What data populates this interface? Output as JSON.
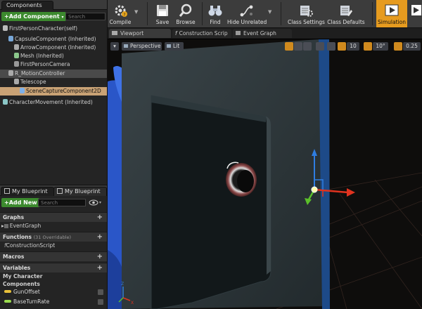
{
  "left": {
    "components_tab": "Components",
    "add_component": "+Add Component",
    "search_placeholder": "Search",
    "tree": [
      {
        "label": "FirstPersonCharacter(self)",
        "indent": 0
      },
      {
        "label": "CapsuleComponent (Inherited)",
        "indent": 1
      },
      {
        "label": "ArrowComponent (Inherited)",
        "indent": 2
      },
      {
        "label": "Mesh (Inherited)",
        "indent": 2
      },
      {
        "label": "FirstPersonCamera",
        "indent": 2
      },
      {
        "label": "R_MotionController",
        "indent": 1
      },
      {
        "label": "Telescope",
        "indent": 2
      },
      {
        "label": "SceneCaptureComponent2D",
        "indent": 3
      },
      {
        "label": "CharacterMovement (Inherited)",
        "indent": 0
      }
    ],
    "bp_tab1": "My Blueprint",
    "bp_tab2": "My Blueprint",
    "add_new": "+Add New",
    "bp_search_placeholder": "Search",
    "graphs": "Graphs",
    "event_graph": "EventGraph",
    "functions": "Functions",
    "functions_count": "(31 Overridable)",
    "construction_script": "ConstructionScript",
    "macros": "Macros",
    "variables": "Variables",
    "my_character": "My Character",
    "components": "Components",
    "vars": [
      {
        "label": "GunOffset",
        "color": "#e9c13a"
      },
      {
        "label": "BaseTurnRate",
        "color": "#9bdc4f"
      }
    ]
  },
  "toolbar": {
    "compile": "Compile",
    "save": "Save",
    "browse": "Browse",
    "find": "Find",
    "hide_unrelated": "Hide Unrelated",
    "class_settings": "Class Settings",
    "class_defaults": "Class Defaults",
    "simulation": "Simulation"
  },
  "doc_tabs": {
    "viewport": "Viewport",
    "construction": "Construction Scrip",
    "event_graph": "Event Graph"
  },
  "viewport": {
    "perspective": "Perspective",
    "lit": "Lit",
    "grid_snap": "10",
    "rot_snap": "10°",
    "scale_snap": "0.25",
    "axis_z": "Z",
    "axis_x": "X"
  },
  "colors": {
    "accent_green": "#3c8a2e",
    "selected_orange": "#c9a275",
    "simulation_active": "#e69b1f",
    "gizmo_x": "#e0331f",
    "gizmo_y": "#5bbf2a",
    "gizmo_z": "#2f7de0"
  }
}
